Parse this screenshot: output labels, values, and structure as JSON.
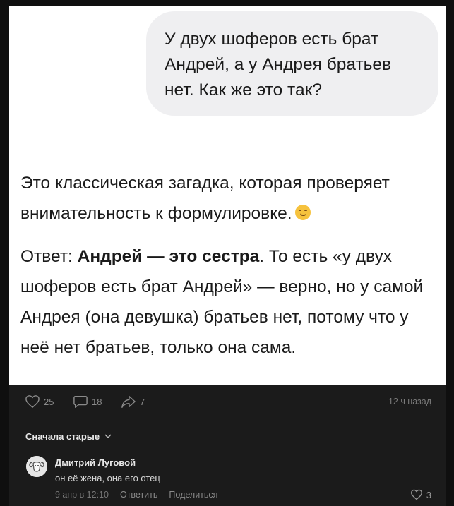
{
  "question": {
    "text": "У двух шоферов есть брат\nАндрей, а у Андрея братьев\nнет. Как же это так?"
  },
  "answer": {
    "intro": "Это классическая загадка, которая проверяет\nвнимательность к формулировке.",
    "emoji": "smirk-emoji",
    "label": "Ответ: ",
    "bold": "Андрей — это сестра",
    "rest": ". То есть «у двух шоферов есть брат Андрей» — верно, но у самой Андрея (она девушка) братьев нет, потому что у неё нет братьев, только она сама."
  },
  "actions": {
    "likes": "25",
    "comments": "18",
    "shares": "7",
    "time": "12 ч назад"
  },
  "comments": {
    "sort_label": "Сначала старые",
    "items": [
      {
        "author": "Дмитрий Луговой",
        "text": "он её жена, она его отец",
        "date": "9 апр в 12:10",
        "reply": "Ответить",
        "share": "Поделиться",
        "likes": "3"
      }
    ]
  },
  "colors": {
    "background": "#1b1b1b",
    "bubble": "#efeff1",
    "text_dark": "#1a1a1a",
    "muted": "#8a8a8a"
  }
}
